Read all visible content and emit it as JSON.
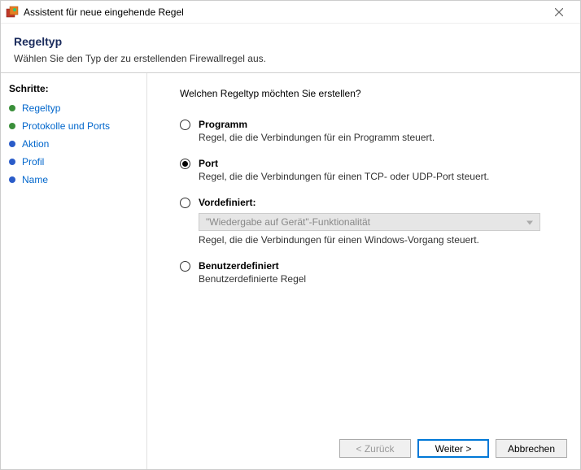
{
  "window": {
    "title": "Assistent für neue eingehende Regel"
  },
  "header": {
    "title": "Regeltyp",
    "subtitle": "Wählen Sie den Typ der zu erstellenden Firewallregel aus."
  },
  "sidebar": {
    "header": "Schritte:",
    "items": [
      {
        "label": "Regeltyp"
      },
      {
        "label": "Protokolle und Ports"
      },
      {
        "label": "Aktion"
      },
      {
        "label": "Profil"
      },
      {
        "label": "Name"
      }
    ]
  },
  "main": {
    "prompt": "Welchen Regeltyp möchten Sie erstellen?",
    "options": {
      "program": {
        "title": "Programm",
        "desc": "Regel, die die Verbindungen für ein Programm steuert."
      },
      "port": {
        "title": "Port",
        "desc": "Regel, die die Verbindungen für einen TCP- oder UDP-Port steuert."
      },
      "predefined": {
        "title": "Vordefiniert:",
        "select_value": "\"Wiedergabe auf Gerät\"-Funktionalität",
        "desc": "Regel, die die Verbindungen für einen Windows-Vorgang steuert."
      },
      "custom": {
        "title": "Benutzerdefiniert",
        "desc": "Benutzerdefinierte Regel"
      }
    },
    "selected": "port"
  },
  "footer": {
    "back": "< Zurück",
    "next": "Weiter >",
    "cancel": "Abbrechen"
  }
}
